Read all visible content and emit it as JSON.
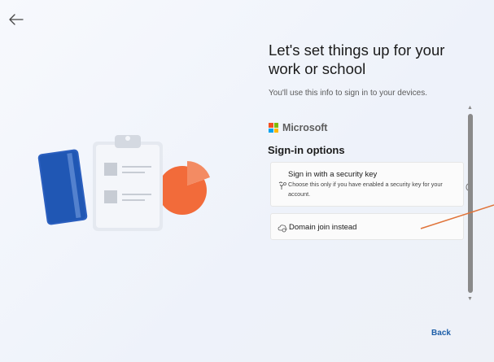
{
  "header": {
    "back_icon": "arrow-left-icon"
  },
  "main": {
    "title": "Let's set things up for your work or school",
    "subtitle": "You'll use this info to sign in to your devices."
  },
  "brand": {
    "name": "Microsoft",
    "logo_colors": [
      "#f25022",
      "#7fba00",
      "#00a4ef",
      "#ffb900"
    ]
  },
  "signin": {
    "section_title": "Sign-in options",
    "options": [
      {
        "title": "Sign in with a security key",
        "description": "Choose this only if you have enabled a security key for your account.",
        "icon": "security-key-icon"
      },
      {
        "title": "Domain join instead",
        "icon": "domain-join-icon"
      }
    ]
  },
  "footer": {
    "back_label": "Back"
  },
  "colors": {
    "accent": "#1d5ea8",
    "annotation_line": "#e0743a"
  }
}
